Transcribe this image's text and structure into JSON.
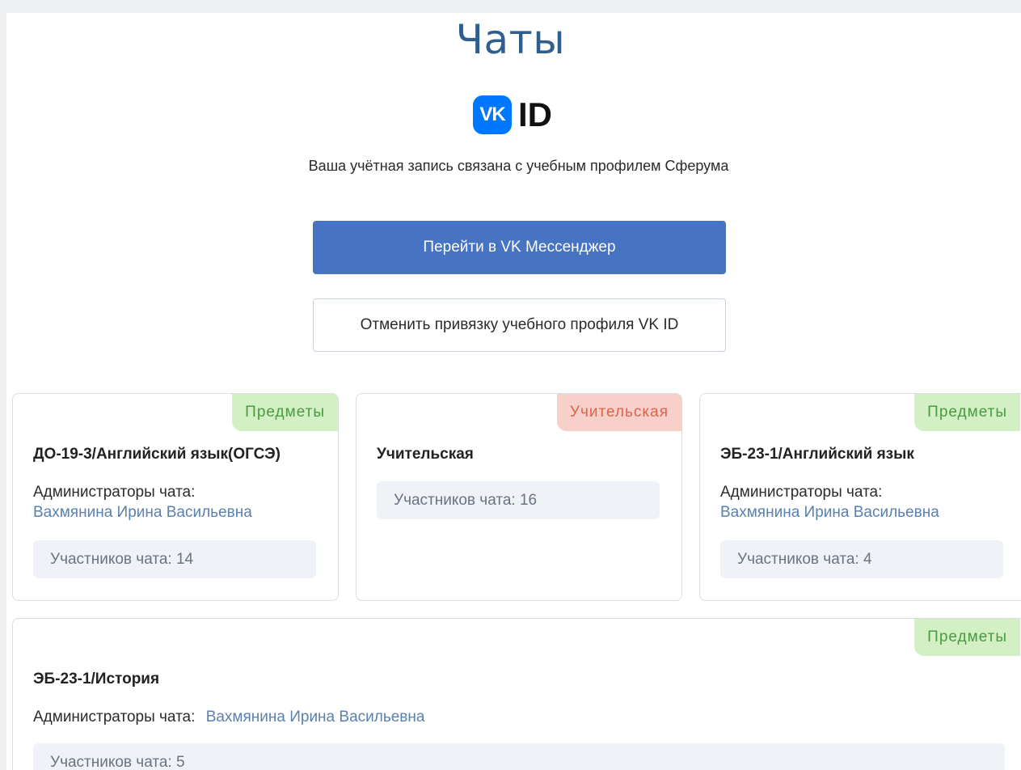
{
  "page": {
    "title": "Чаты",
    "vk_logo": "VK",
    "vk_id_text": "ID",
    "subtitle": "Ваша учётная запись связана с учебным профилем Сферума",
    "primary_button": "Перейти в VK Мессенджер",
    "secondary_button": "Отменить привязку учебного профиля VK ID"
  },
  "colors": {
    "primary": "#4673c2",
    "vk_blue": "#0077ff",
    "tag_green_bg": "#d3f0c4",
    "tag_red_bg": "#f6d0c9",
    "admin_link": "#5a80b0"
  },
  "chats": [
    {
      "tag": "Предметы",
      "name": "ДО-19-3/Английский язык(ОГСЭ)",
      "admin_label": "Администраторы чата:",
      "admin": "Вахмянина Ирина Васильевна",
      "members": "Участников чата: 14"
    },
    {
      "tag": "Учительская",
      "name": "Учительская",
      "members": "Участников чата: 16"
    },
    {
      "tag": "Предметы",
      "name": "ЭБ-23-1/Английский язык",
      "admin_label": "Администраторы чата:",
      "admin": "Вахмянина Ирина Васильевна",
      "members": "Участников чата: 4"
    },
    {
      "tag": "Предметы",
      "name": "ЭБ-23-1/История",
      "admin_label": "Администраторы чата:",
      "admin": "Вахмянина Ирина Васильевна",
      "members": "Участников чата: 5"
    }
  ]
}
